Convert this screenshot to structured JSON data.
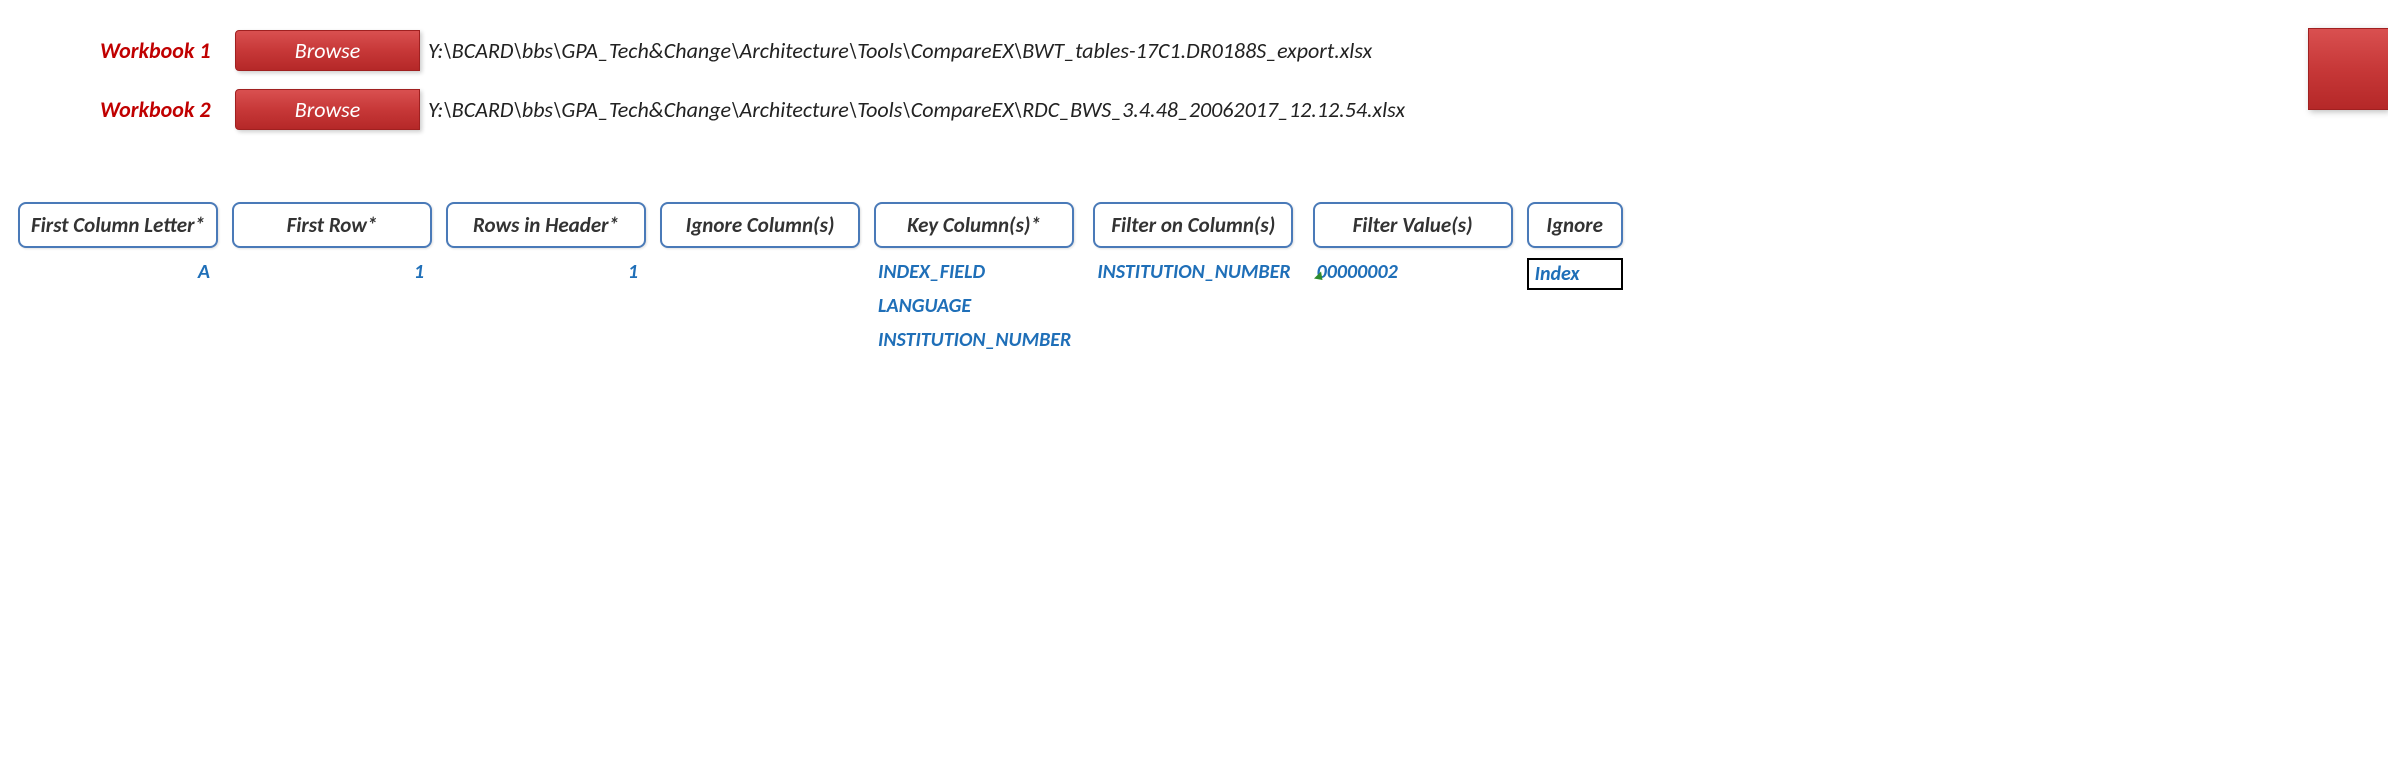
{
  "workbooks": [
    {
      "label": "Workbook 1",
      "browse_label": "Browse",
      "path": "Y:\\BCARD\\bbs\\GPA_Tech&Change\\Architecture\\Tools\\CompareEX\\BWT_tables-17C1.DR0188S_export.xlsx"
    },
    {
      "label": "Workbook 2",
      "browse_label": "Browse",
      "path": "Y:\\BCARD\\bbs\\GPA_Tech&Change\\Architecture\\Tools\\CompareEX\\RDC_BWS_3.4.48_20062017_12.12.54.xlsx"
    }
  ],
  "columns": {
    "first_column_letter": {
      "header": "First Column Letter*",
      "value": "A"
    },
    "first_row": {
      "header": "First Row*",
      "value": "1"
    },
    "rows_in_header": {
      "header": "Rows in Header*",
      "value": "1"
    },
    "ignore_columns": {
      "header": "Ignore Column(s)",
      "value": ""
    },
    "key_columns": {
      "header": "Key Column(s)*",
      "values": [
        "INDEX_FIELD",
        "LANGUAGE",
        "INSTITUTION_NUMBER"
      ]
    },
    "filter_on_columns": {
      "header": "Filter on Column(s)",
      "value": "INSTITUTION_NUMBER"
    },
    "filter_values": {
      "header": "Filter Value(s)",
      "value": "00000002"
    },
    "ignore_partial": {
      "header": "Ignore",
      "value": "Index"
    }
  }
}
